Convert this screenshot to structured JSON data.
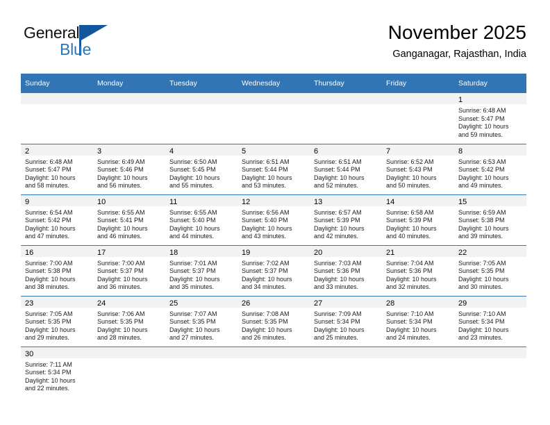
{
  "brand": {
    "name_part1": "General",
    "name_part2": "Blue",
    "accent_color": "#2e75b6",
    "flag_color": "#14569e"
  },
  "header": {
    "title": "November 2025",
    "subtitle": "Ganganagar, Rajasthan, India"
  },
  "theme": {
    "header_blue": "#3175b5",
    "daynum_band": "#f2f2f2",
    "row_rule": "#3175b5"
  },
  "weekdays": [
    "Sunday",
    "Monday",
    "Tuesday",
    "Wednesday",
    "Thursday",
    "Friday",
    "Saturday"
  ],
  "weeks": [
    [
      {
        "day": "",
        "sunrise": "",
        "sunset": "",
        "daylight1": "",
        "daylight2": "",
        "empty": true
      },
      {
        "day": "",
        "sunrise": "",
        "sunset": "",
        "daylight1": "",
        "daylight2": "",
        "empty": true
      },
      {
        "day": "",
        "sunrise": "",
        "sunset": "",
        "daylight1": "",
        "daylight2": "",
        "empty": true
      },
      {
        "day": "",
        "sunrise": "",
        "sunset": "",
        "daylight1": "",
        "daylight2": "",
        "empty": true
      },
      {
        "day": "",
        "sunrise": "",
        "sunset": "",
        "daylight1": "",
        "daylight2": "",
        "empty": true
      },
      {
        "day": "",
        "sunrise": "",
        "sunset": "",
        "daylight1": "",
        "daylight2": "",
        "empty": true
      },
      {
        "day": "1",
        "sunrise": "Sunrise: 6:48 AM",
        "sunset": "Sunset: 5:47 PM",
        "daylight1": "Daylight: 10 hours",
        "daylight2": "and 59 minutes.",
        "empty": false
      }
    ],
    [
      {
        "day": "2",
        "sunrise": "Sunrise: 6:48 AM",
        "sunset": "Sunset: 5:47 PM",
        "daylight1": "Daylight: 10 hours",
        "daylight2": "and 58 minutes.",
        "empty": false
      },
      {
        "day": "3",
        "sunrise": "Sunrise: 6:49 AM",
        "sunset": "Sunset: 5:46 PM",
        "daylight1": "Daylight: 10 hours",
        "daylight2": "and 56 minutes.",
        "empty": false
      },
      {
        "day": "4",
        "sunrise": "Sunrise: 6:50 AM",
        "sunset": "Sunset: 5:45 PM",
        "daylight1": "Daylight: 10 hours",
        "daylight2": "and 55 minutes.",
        "empty": false
      },
      {
        "day": "5",
        "sunrise": "Sunrise: 6:51 AM",
        "sunset": "Sunset: 5:44 PM",
        "daylight1": "Daylight: 10 hours",
        "daylight2": "and 53 minutes.",
        "empty": false
      },
      {
        "day": "6",
        "sunrise": "Sunrise: 6:51 AM",
        "sunset": "Sunset: 5:44 PM",
        "daylight1": "Daylight: 10 hours",
        "daylight2": "and 52 minutes.",
        "empty": false
      },
      {
        "day": "7",
        "sunrise": "Sunrise: 6:52 AM",
        "sunset": "Sunset: 5:43 PM",
        "daylight1": "Daylight: 10 hours",
        "daylight2": "and 50 minutes.",
        "empty": false
      },
      {
        "day": "8",
        "sunrise": "Sunrise: 6:53 AM",
        "sunset": "Sunset: 5:42 PM",
        "daylight1": "Daylight: 10 hours",
        "daylight2": "and 49 minutes.",
        "empty": false
      }
    ],
    [
      {
        "day": "9",
        "sunrise": "Sunrise: 6:54 AM",
        "sunset": "Sunset: 5:42 PM",
        "daylight1": "Daylight: 10 hours",
        "daylight2": "and 47 minutes.",
        "empty": false
      },
      {
        "day": "10",
        "sunrise": "Sunrise: 6:55 AM",
        "sunset": "Sunset: 5:41 PM",
        "daylight1": "Daylight: 10 hours",
        "daylight2": "and 46 minutes.",
        "empty": false
      },
      {
        "day": "11",
        "sunrise": "Sunrise: 6:55 AM",
        "sunset": "Sunset: 5:40 PM",
        "daylight1": "Daylight: 10 hours",
        "daylight2": "and 44 minutes.",
        "empty": false
      },
      {
        "day": "12",
        "sunrise": "Sunrise: 6:56 AM",
        "sunset": "Sunset: 5:40 PM",
        "daylight1": "Daylight: 10 hours",
        "daylight2": "and 43 minutes.",
        "empty": false
      },
      {
        "day": "13",
        "sunrise": "Sunrise: 6:57 AM",
        "sunset": "Sunset: 5:39 PM",
        "daylight1": "Daylight: 10 hours",
        "daylight2": "and 42 minutes.",
        "empty": false
      },
      {
        "day": "14",
        "sunrise": "Sunrise: 6:58 AM",
        "sunset": "Sunset: 5:39 PM",
        "daylight1": "Daylight: 10 hours",
        "daylight2": "and 40 minutes.",
        "empty": false
      },
      {
        "day": "15",
        "sunrise": "Sunrise: 6:59 AM",
        "sunset": "Sunset: 5:38 PM",
        "daylight1": "Daylight: 10 hours",
        "daylight2": "and 39 minutes.",
        "empty": false
      }
    ],
    [
      {
        "day": "16",
        "sunrise": "Sunrise: 7:00 AM",
        "sunset": "Sunset: 5:38 PM",
        "daylight1": "Daylight: 10 hours",
        "daylight2": "and 38 minutes.",
        "empty": false
      },
      {
        "day": "17",
        "sunrise": "Sunrise: 7:00 AM",
        "sunset": "Sunset: 5:37 PM",
        "daylight1": "Daylight: 10 hours",
        "daylight2": "and 36 minutes.",
        "empty": false
      },
      {
        "day": "18",
        "sunrise": "Sunrise: 7:01 AM",
        "sunset": "Sunset: 5:37 PM",
        "daylight1": "Daylight: 10 hours",
        "daylight2": "and 35 minutes.",
        "empty": false
      },
      {
        "day": "19",
        "sunrise": "Sunrise: 7:02 AM",
        "sunset": "Sunset: 5:37 PM",
        "daylight1": "Daylight: 10 hours",
        "daylight2": "and 34 minutes.",
        "empty": false
      },
      {
        "day": "20",
        "sunrise": "Sunrise: 7:03 AM",
        "sunset": "Sunset: 5:36 PM",
        "daylight1": "Daylight: 10 hours",
        "daylight2": "and 33 minutes.",
        "empty": false
      },
      {
        "day": "21",
        "sunrise": "Sunrise: 7:04 AM",
        "sunset": "Sunset: 5:36 PM",
        "daylight1": "Daylight: 10 hours",
        "daylight2": "and 32 minutes.",
        "empty": false
      },
      {
        "day": "22",
        "sunrise": "Sunrise: 7:05 AM",
        "sunset": "Sunset: 5:35 PM",
        "daylight1": "Daylight: 10 hours",
        "daylight2": "and 30 minutes.",
        "empty": false
      }
    ],
    [
      {
        "day": "23",
        "sunrise": "Sunrise: 7:05 AM",
        "sunset": "Sunset: 5:35 PM",
        "daylight1": "Daylight: 10 hours",
        "daylight2": "and 29 minutes.",
        "empty": false
      },
      {
        "day": "24",
        "sunrise": "Sunrise: 7:06 AM",
        "sunset": "Sunset: 5:35 PM",
        "daylight1": "Daylight: 10 hours",
        "daylight2": "and 28 minutes.",
        "empty": false
      },
      {
        "day": "25",
        "sunrise": "Sunrise: 7:07 AM",
        "sunset": "Sunset: 5:35 PM",
        "daylight1": "Daylight: 10 hours",
        "daylight2": "and 27 minutes.",
        "empty": false
      },
      {
        "day": "26",
        "sunrise": "Sunrise: 7:08 AM",
        "sunset": "Sunset: 5:35 PM",
        "daylight1": "Daylight: 10 hours",
        "daylight2": "and 26 minutes.",
        "empty": false
      },
      {
        "day": "27",
        "sunrise": "Sunrise: 7:09 AM",
        "sunset": "Sunset: 5:34 PM",
        "daylight1": "Daylight: 10 hours",
        "daylight2": "and 25 minutes.",
        "empty": false
      },
      {
        "day": "28",
        "sunrise": "Sunrise: 7:10 AM",
        "sunset": "Sunset: 5:34 PM",
        "daylight1": "Daylight: 10 hours",
        "daylight2": "and 24 minutes.",
        "empty": false
      },
      {
        "day": "29",
        "sunrise": "Sunrise: 7:10 AM",
        "sunset": "Sunset: 5:34 PM",
        "daylight1": "Daylight: 10 hours",
        "daylight2": "and 23 minutes.",
        "empty": false
      }
    ],
    [
      {
        "day": "30",
        "sunrise": "Sunrise: 7:11 AM",
        "sunset": "Sunset: 5:34 PM",
        "daylight1": "Daylight: 10 hours",
        "daylight2": "and 22 minutes.",
        "empty": false
      },
      {
        "day": "",
        "sunrise": "",
        "sunset": "",
        "daylight1": "",
        "daylight2": "",
        "empty": true
      },
      {
        "day": "",
        "sunrise": "",
        "sunset": "",
        "daylight1": "",
        "daylight2": "",
        "empty": true
      },
      {
        "day": "",
        "sunrise": "",
        "sunset": "",
        "daylight1": "",
        "daylight2": "",
        "empty": true
      },
      {
        "day": "",
        "sunrise": "",
        "sunset": "",
        "daylight1": "",
        "daylight2": "",
        "empty": true
      },
      {
        "day": "",
        "sunrise": "",
        "sunset": "",
        "daylight1": "",
        "daylight2": "",
        "empty": true
      },
      {
        "day": "",
        "sunrise": "",
        "sunset": "",
        "daylight1": "",
        "daylight2": "",
        "empty": true
      }
    ]
  ]
}
